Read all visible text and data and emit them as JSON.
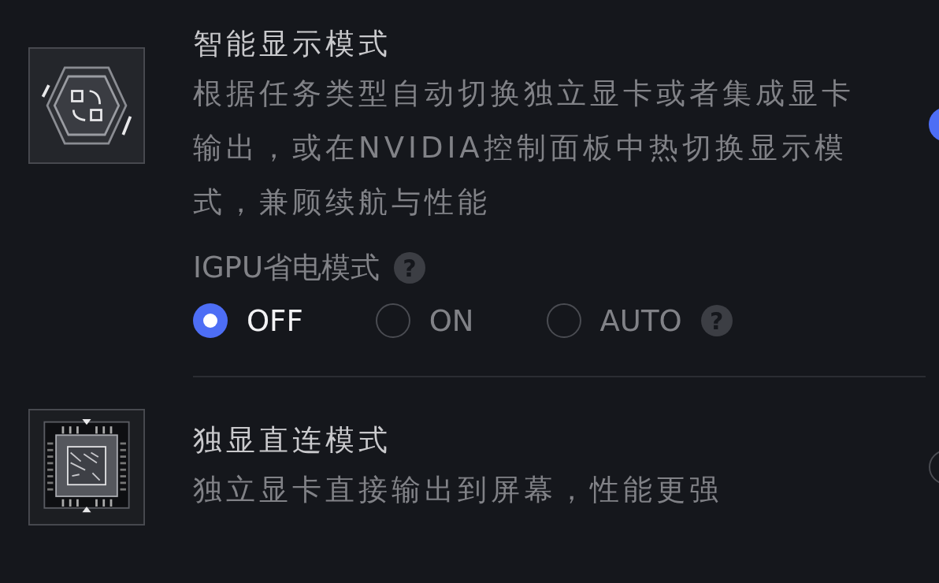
{
  "modes": [
    {
      "kind": "smart",
      "title": "智能显示模式",
      "description": "根据任务类型自动切换独立显卡或者集成显卡输出，或在NVIDIA控制面板中热切换显示模式，兼顾续航与性能",
      "selected": true,
      "igpu": {
        "label": "IGPU省电模式",
        "help": "?",
        "options": [
          {
            "label": "OFF",
            "selected": true
          },
          {
            "label": "ON",
            "selected": false
          },
          {
            "label": "AUTO",
            "selected": false,
            "help": "?"
          }
        ]
      }
    },
    {
      "kind": "direct",
      "title": "独显直连模式",
      "description": "独立显卡直接输出到屏幕，性能更强",
      "selected": false
    }
  ]
}
